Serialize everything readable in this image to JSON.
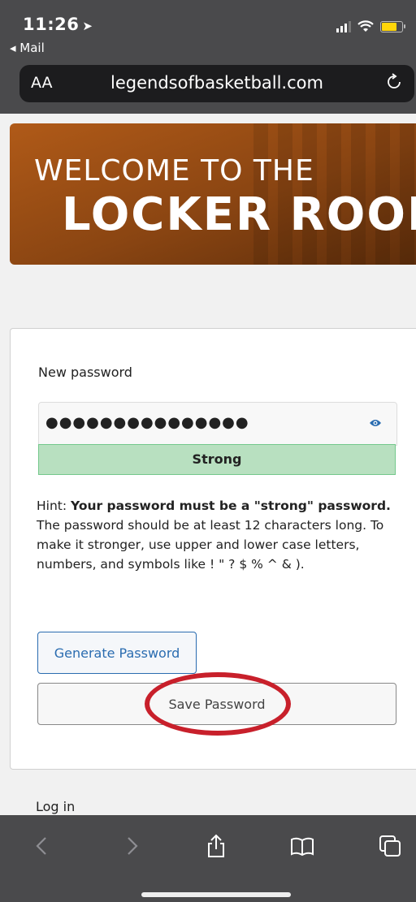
{
  "status_bar": {
    "time": "11:26",
    "location_arrow": "➤",
    "back_label": "◂ Mail"
  },
  "browser": {
    "text_size_label": "AA",
    "domain": "legendsofbasketball.com"
  },
  "hero": {
    "line1": "WELCOME TO THE",
    "line2": "LOCKER ROOM"
  },
  "form": {
    "new_password_label": "New password",
    "password_mask": "●●●●●●●●●●●●●●●",
    "strength": "Strong",
    "hint_prefix": "Hint: ",
    "hint_bold": "Your password must be a \"strong\" password.",
    "hint_rest": " The password should be at least 12 characters long. To make it stronger, use upper and lower case letters, numbers, and symbols like ! \" ? $ % ^ & ).",
    "generate_label": "Generate Password",
    "save_label": "Save Password"
  },
  "login_label": "Log in",
  "colors": {
    "accent_link": "#2a6cb0",
    "strength_bg": "#b8e0c0",
    "annotation_circle": "#c8202b",
    "battery": "#ffd60a"
  },
  "icons": [
    "location-arrow-icon",
    "signal-icon",
    "wifi-icon",
    "battery-icon",
    "reload-icon",
    "eye-icon",
    "back-icon",
    "forward-icon",
    "share-icon",
    "bookmarks-icon",
    "tabs-icon"
  ]
}
